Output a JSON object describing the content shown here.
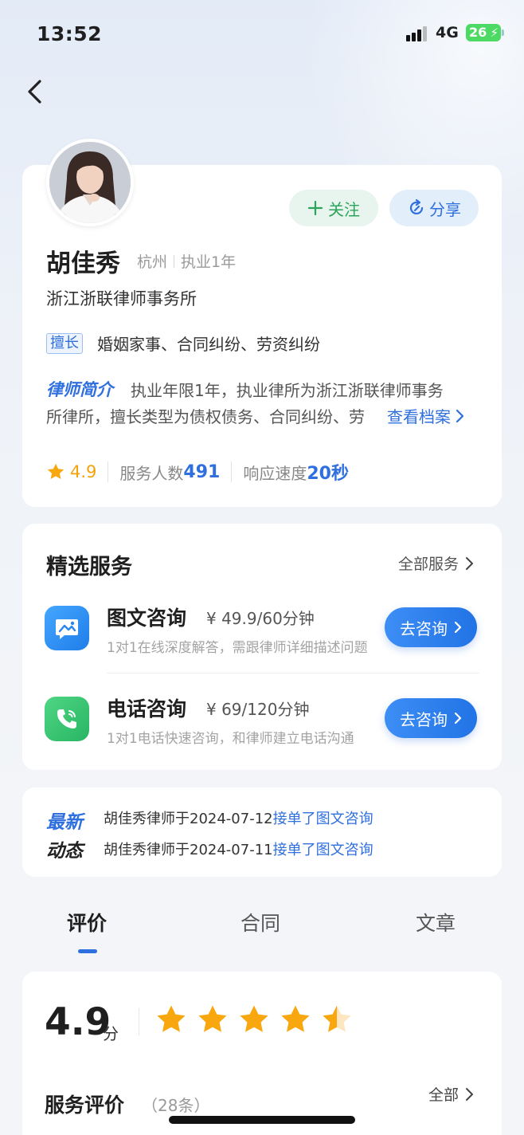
{
  "status_bar": {
    "time": "13:52",
    "network": "4G",
    "battery": "26"
  },
  "profile": {
    "name": "胡佳秀",
    "city": "杭州",
    "practice_years": "执业1年",
    "firm": "浙江浙联律师事务所",
    "follow_label": "关注",
    "share_label": "分享",
    "specialty_tag": "擅长",
    "specialties": "婚姻家事、合同纠纷、劳资纠纷",
    "intro_title": "律师简介",
    "intro_line1": "执业年限1年，执业律所为浙江浙联律师事务",
    "intro_line2": "所律所，擅长类型为债权债务、合同纠纷、劳",
    "view_profile_label": "查看档案",
    "rating": "4.9",
    "served_label": "服务人数",
    "served_count": "491",
    "response_label": "响应速度",
    "response_value": "20秒"
  },
  "services": {
    "title": "精选服务",
    "all_label": "全部服务",
    "items": [
      {
        "name": "图文咨询",
        "price": "¥ 49.9/60分钟",
        "desc": "1对1在线深度解答，需跟律师详细描述问题",
        "button": "去咨询",
        "icon": "image-chat-icon"
      },
      {
        "name": "电话咨询",
        "price": "¥ 69/120分钟",
        "desc": "1对1电话快速咨询，和律师建立电话沟通",
        "button": "去咨询",
        "icon": "phone-icon"
      }
    ]
  },
  "news": {
    "label_line1": "最新",
    "label_line2": "动态",
    "items": [
      {
        "text": "胡佳秀律师于2024-07-12",
        "highlight": "接单了图文咨询"
      },
      {
        "text": "胡佳秀律师于2024-07-11",
        "highlight": "接单了图文咨询"
      }
    ]
  },
  "tabs": [
    {
      "label": "评价",
      "active": true
    },
    {
      "label": "合同",
      "active": false
    },
    {
      "label": "文章",
      "active": false
    }
  ],
  "reviews": {
    "score": "4.9",
    "unit": "分",
    "stars_value": 4.5,
    "title": "服务评价",
    "count": "（28条）",
    "all_label": "全部"
  },
  "colors": {
    "accent": "#2f6fde",
    "star": "#f8a70f",
    "follow": "#2ca35a"
  }
}
